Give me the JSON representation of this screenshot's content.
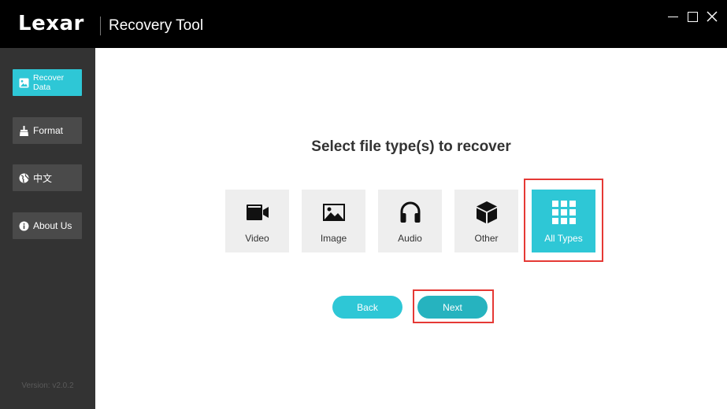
{
  "app": {
    "logo_left": "Le",
    "logo_x": "x",
    "logo_right": "ar",
    "title": "Recovery Tool"
  },
  "sidebar": {
    "items": [
      {
        "label": "Recover Data",
        "icon": "image-icon",
        "active": true
      },
      {
        "label": "Format",
        "icon": "broom-icon",
        "active": false
      },
      {
        "label": "中文",
        "icon": "globe-icon",
        "active": false
      },
      {
        "label": "About Us",
        "icon": "info-icon",
        "active": false
      }
    ],
    "version": "Version: v2.0.2"
  },
  "main": {
    "heading": "Select file type(s) to recover",
    "file_types": [
      {
        "label": "Video",
        "icon": "video-camera-icon",
        "selected": false
      },
      {
        "label": "Image",
        "icon": "picture-icon",
        "selected": false
      },
      {
        "label": "Audio",
        "icon": "headphones-icon",
        "selected": false
      },
      {
        "label": "Other",
        "icon": "cube-icon",
        "selected": false
      },
      {
        "label": "All Types",
        "icon": "grid-icon",
        "selected": true
      }
    ],
    "back_label": "Back",
    "next_label": "Next"
  },
  "colors": {
    "accent": "#2ec7d6",
    "next_button": "#26b3bf",
    "highlight": "#e53935",
    "titlebar": "#000000",
    "sidebar": "#333333"
  }
}
